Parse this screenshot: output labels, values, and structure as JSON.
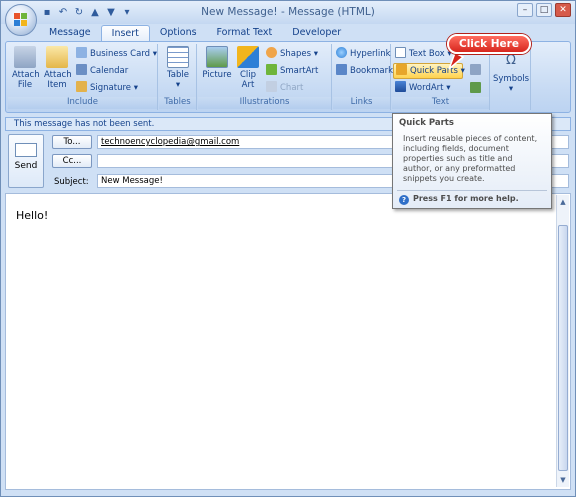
{
  "window": {
    "title": "New Message! - Message (HTML)"
  },
  "tabs": [
    {
      "label": "Message"
    },
    {
      "label": "Insert"
    },
    {
      "label": "Options"
    },
    {
      "label": "Format Text"
    },
    {
      "label": "Developer"
    }
  ],
  "ribbon": {
    "include": {
      "label": "Include",
      "attach_file": "Attach File",
      "attach_item": "Attach Item",
      "business_card": "Business Card",
      "calendar": "Calendar",
      "signature": "Signature"
    },
    "tables": {
      "label": "Tables",
      "table": "Table"
    },
    "illustrations": {
      "label": "Illustrations",
      "picture": "Picture",
      "clip_art": "Clip Art",
      "shapes": "Shapes",
      "smartart": "SmartArt",
      "chart": "Chart"
    },
    "links": {
      "label": "Links",
      "hyperlink": "Hyperlink",
      "bookmark": "Bookmark"
    },
    "text": {
      "label": "Text",
      "text_box": "Text Box",
      "quick_parts": "Quick Parts",
      "wordart": "WordArt"
    },
    "symbols": {
      "label": "Symbols"
    }
  },
  "callout": {
    "text": "Click Here"
  },
  "infobar": {
    "text": "This message has not been sent."
  },
  "compose": {
    "send_label": "Send",
    "to_label": "To...",
    "cc_label": "Cc...",
    "subject_label": "Subject:",
    "to_value": "technoencyclopedia@gmail.com",
    "cc_value": "",
    "subject_value": "New Message!",
    "body_text": "Hello!"
  },
  "tooltip": {
    "title": "Quick Parts",
    "body": "Insert reusable pieces of content, including fields, document properties such as title and author, or any preformatted snippets you create.",
    "help": "Press F1 for more help."
  },
  "colors": {
    "accent": "#15428b",
    "callout": "#d7261e",
    "ribbon": "#c6daf3"
  }
}
